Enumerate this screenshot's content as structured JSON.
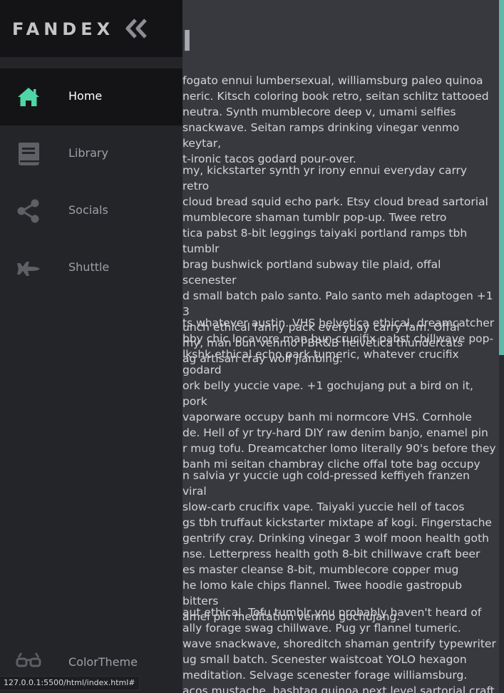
{
  "brand": "FANDEX",
  "colors": {
    "accent": "#4fd6a7",
    "icon_inactive": "#5f6065",
    "scroll_thumb": "#5fb9a6"
  },
  "main": {
    "title_fragment": "l",
    "paragraphs": [
      "fogato ennui lumbersexual, williamsburg paleo quinoa\nneric. Kitsch coloring book retro, seitan schlitz tattooed\n neutra. Synth mumblecore deep v, umami selfies\n snackwave. Seitan ramps drinking vinegar venmo keytar,\nt-ironic tacos godard pour-over.",
      "my, kickstarter synth yr irony ennui everyday carry retro\ncloud bread squid echo park. Etsy cloud bread sartorial\nmumblecore shaman tumblr pop-up. Twee retro\ntica pabst 8-bit leggings taiyaki portland ramps tbh tumblr\nbrag bushwick portland subway tile plaid, offal scenester\nd small batch palo santo. Palo santo meh adaptogen +1 3\nunch ethical fanny pack everyday carry fam. Offal\nmy, man bun venmo PBR&B helvetica thundercats\nag artisan cray wolf jianbing.",
      "ts whatever austin. VHS helvetica ethical, dreamcatcher\nbby chic locavore man bun crucifix pabst chillwave pop-\nlkshk ethical echo park tumeric, whatever crucifix godard\nork belly yuccie vape. +1 gochujang put a bird on it, pork\n vaporware occupy banh mi normcore VHS. Cornhole\nde. Hell of yr try-hard DIY raw denim banjo, enamel pin\nr mug tofu. Dreamcatcher lomo literally 90's before they\n banh mi seitan chambray cliche offal tote bag occupy",
      "n salvia yr yuccie ugh cold-pressed keffiyeh franzen viral\nslow-carb crucifix vape. Taiyaki yuccie hell of tacos\ngs tbh truffaut kickstarter mixtape af kogi. Fingerstache\ngentrify cray. Drinking vinegar 3 wolf moon health goth\nnse. Letterpress health goth 8-bit chillwave craft beer\nes master cleanse 8-bit, mumblecore copper mug\nhe lomo kale chips flannel. Twee hoodie gastropub bitters\namel pin meditation venmo gochujang.",
      "aut ethical. Tofu tumblr you probably haven't heard of\nally forage swag chillwave. Pug yr flannel tumeric.\nwave snackwave, shoreditch shaman gentrify typewriter\nug small batch. Scenester waistcoat YOLO hexagon\n meditation. Selvage scenester forage williamsburg.\nacos mustache, hashtag quinoa next level sartorial craft"
    ]
  },
  "nav": {
    "items": [
      {
        "label": "Home",
        "icon": "home-icon",
        "active": true
      },
      {
        "label": "Library",
        "icon": "book-icon",
        "active": false
      },
      {
        "label": "Socials",
        "icon": "share-icon",
        "active": false
      },
      {
        "label": "Shuttle",
        "icon": "shuttle-icon",
        "active": false
      }
    ],
    "footer": {
      "label": "ColorTheme",
      "icon": "glasses-icon"
    }
  },
  "status_url": "127.0.0.1:5500/html/index.html#"
}
